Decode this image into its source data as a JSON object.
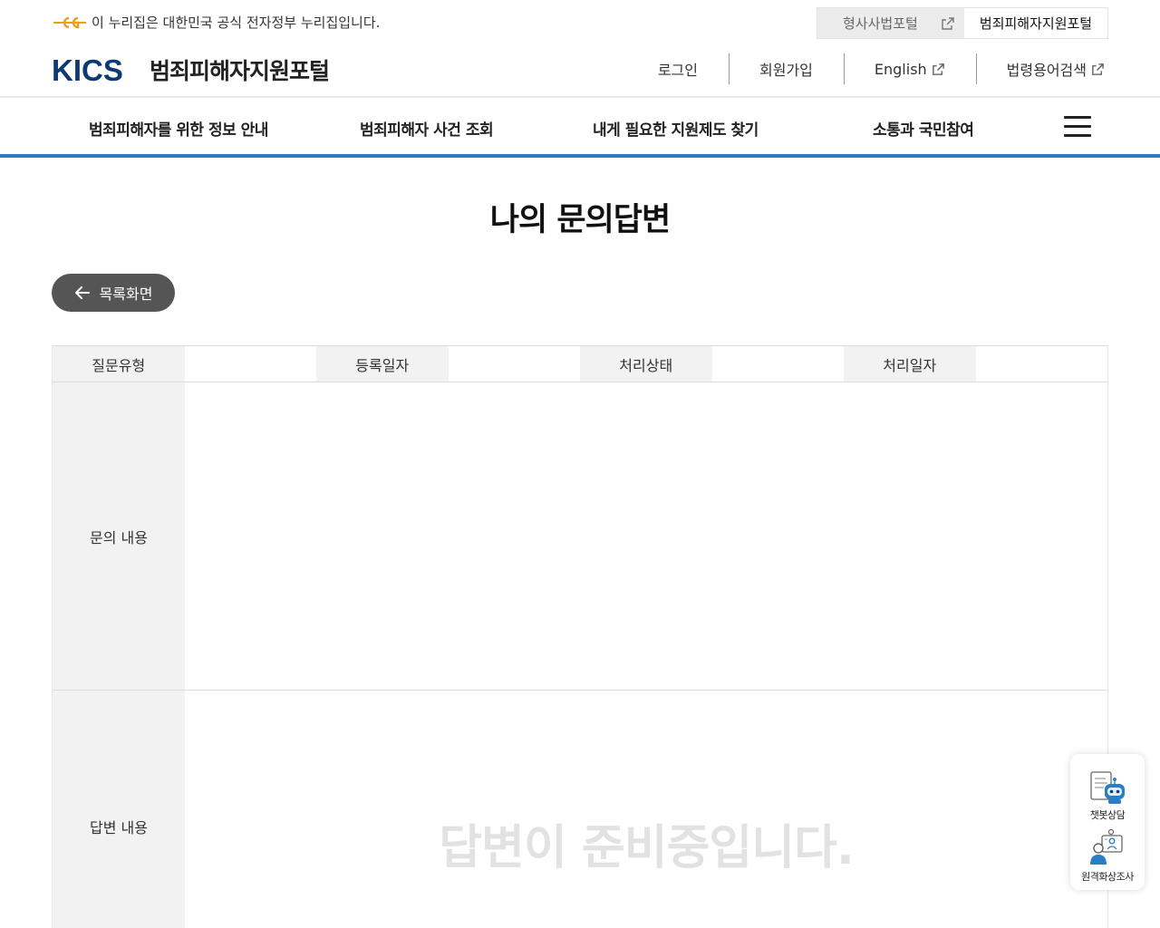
{
  "gov_bar": {
    "notice": "이 누리집은 대한민국 공식 전자정부 누리집입니다.",
    "portals": [
      {
        "label": "형사사법포털"
      },
      {
        "label": "범죄피해자지원포털"
      }
    ]
  },
  "header": {
    "logo_mark": "KICS",
    "logo_name": "범죄피해자지원포털",
    "util": [
      {
        "label": "로그인"
      },
      {
        "label": "회원가입"
      },
      {
        "label": "English"
      },
      {
        "label": "법령용어검색"
      }
    ]
  },
  "gnb": {
    "items": [
      {
        "label": "범죄피해자를 위한 정보 안내"
      },
      {
        "label": "범죄피해자 사건 조회"
      },
      {
        "label": "내게 필요한 지원제도 찾기"
      },
      {
        "label": "소통과 국민참여"
      }
    ]
  },
  "page": {
    "title": "나의 문의답변",
    "back_label": "목록화면"
  },
  "detail": {
    "meta": [
      {
        "label": "질문유형",
        "value": ""
      },
      {
        "label": "등록일자",
        "value": ""
      },
      {
        "label": "처리상태",
        "value": ""
      },
      {
        "label": "처리일자",
        "value": ""
      }
    ],
    "question_label": "문의 내용",
    "question_value": "",
    "answer_label": "답변 내용",
    "answer_empty": "답변이 준비중입니다."
  },
  "quick_menu": [
    {
      "label": "챗봇상담",
      "icon": "chatbot-icon"
    },
    {
      "label": "원격화상조사",
      "icon": "video-call-icon"
    }
  ],
  "colors": {
    "accent": "#2a7fc4",
    "logo": "#0d3a73",
    "button": "#555555",
    "th_bg": "#f2f2f2"
  }
}
